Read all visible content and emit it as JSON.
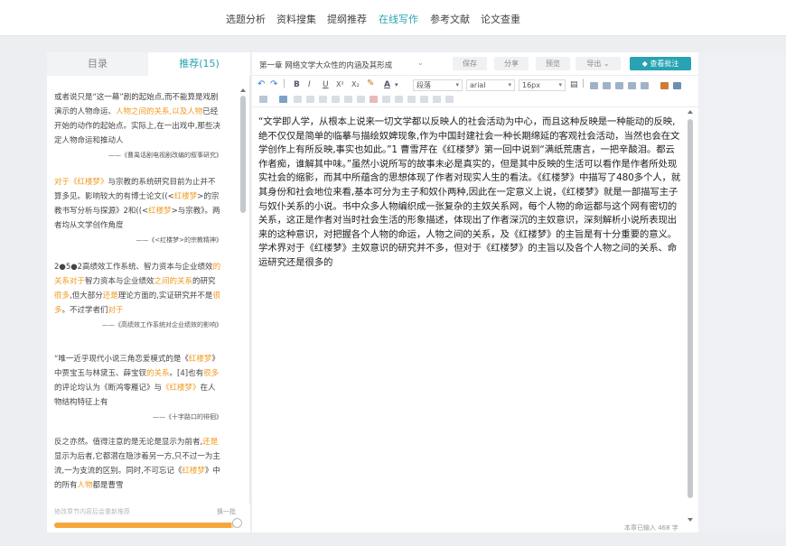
{
  "nav": {
    "items": [
      {
        "label": "选题分析",
        "active": false
      },
      {
        "label": "资料搜集",
        "active": false
      },
      {
        "label": "提纲推荐",
        "active": false
      },
      {
        "label": "在线写作",
        "active": true
      },
      {
        "label": "参考文献",
        "active": false
      },
      {
        "label": "论文查重",
        "active": false
      }
    ],
    "accent_color": "#27a3b3"
  },
  "left_panel": {
    "tabs": {
      "toc": "目录",
      "recommend": "推荐(15)"
    },
    "active_tab": "recommend",
    "recommendations": [
      {
        "segments": [
          {
            "t": "或者说只是“这一幕”剧的起始点,而不能算是戏剧演示的人物命运、",
            "hl": false
          },
          {
            "t": "人物之间的关系,以及人物",
            "hl": true
          },
          {
            "t": "已经开始的动作的起始点。实际上,在一出戏中,那些决定人物命运和推动人",
            "hl": false
          }
        ],
        "source": "——《曹禺话剧电视剧改编的叙事研究》"
      },
      {
        "segments": [
          {
            "t": "对于《红楼梦》",
            "hl": true
          },
          {
            "t": "与宗教的系统研究目前为止并不算多见。影响较大的有博士论文((<",
            "hl": false
          },
          {
            "t": "红楼梦",
            "hl": true
          },
          {
            "t": ">的宗教书写分析与探源》2和((<",
            "hl": false
          },
          {
            "t": "红楼梦",
            "hl": true
          },
          {
            "t": ">与宗教》。两者均从文学创作角度",
            "hl": false
          }
        ],
        "source": "——《<红楼梦>的宗教精神》"
      },
      {
        "segments": [
          {
            "t": "2●5●2高绩效工作系统、智力资本与企业绩效",
            "hl": false
          },
          {
            "t": "的关系对于",
            "hl": true
          },
          {
            "t": "智力资本与企业绩效",
            "hl": false
          },
          {
            "t": "之间的关系",
            "hl": true
          },
          {
            "t": "的研究",
            "hl": false
          },
          {
            "t": "很多",
            "hl": true
          },
          {
            "t": ",但大部分",
            "hl": false
          },
          {
            "t": "还是",
            "hl": true
          },
          {
            "t": "理论方面的,实证研究并不是",
            "hl": false
          },
          {
            "t": "很多",
            "hl": true
          },
          {
            "t": "。不过学者们",
            "hl": false
          },
          {
            "t": "对于",
            "hl": true
          }
        ],
        "source": "——《高绩效工作系统对企业绩效的影响》"
      },
      {
        "segments": [
          {
            "t": "“唯一近乎现代小说三角恋爱模式的是《",
            "hl": false
          },
          {
            "t": "红楼梦",
            "hl": true
          },
          {
            "t": "》中贾宝玉与林黛玉、薛宝钗",
            "hl": false
          },
          {
            "t": "的关系",
            "hl": true
          },
          {
            "t": "。[4]也有",
            "hl": false
          },
          {
            "t": "很多",
            "hl": true
          },
          {
            "t": "的评论均认为《断鸿零雁记》与",
            "hl": false
          },
          {
            "t": "《红楼梦》",
            "hl": true
          },
          {
            "t": "在人物结构特征上有",
            "hl": false
          }
        ],
        "source": "——《十字路口的徘徊》"
      },
      {
        "segments": [
          {
            "t": "反之亦然。值得注意的是无论是显示为前者,",
            "hl": false
          },
          {
            "t": "还是",
            "hl": true
          },
          {
            "t": "显示为后者,它都潜在隐涉着另一方,只不过一为主流,一为支流的区别。同时,不可忘记《",
            "hl": false
          },
          {
            "t": "红楼梦",
            "hl": true
          },
          {
            "t": "》中的所有",
            "hl": false
          },
          {
            "t": "人物",
            "hl": true
          },
          {
            "t": "都是曹雪",
            "hl": false
          }
        ],
        "source": ""
      }
    ],
    "footer_note": "修改章节内容后会重新推荐",
    "refresh_label": "换一批",
    "progress_fraction": 0.98
  },
  "editor": {
    "chapter_title": "第一章 网络文学大众性的内涵及其形成",
    "buttons": {
      "save": "保存",
      "share": "分享",
      "preview": "预览",
      "export": "导出",
      "annotation": "查看批注"
    },
    "toolbar": {
      "bold": "B",
      "italic": "I",
      "underline": "U",
      "superscript": "X²",
      "subscript": "X₂",
      "font_color": "A",
      "paragraph_style": "段落",
      "font_family": "arial",
      "font_size": "16px",
      "omega": "Ω"
    },
    "body_text": "“文学即人学，从根本上说来一切文学都以反映人的社会活动为中心，而且这种反映是一种能动的反映,绝不仅仅是简单的临摹与描绘奴婢现象,作为中国封建社会一种长期绵延的客观社会活动，当然也会在文学创作上有所反映,事实也如此。”1 曹雪芹在《红楼梦》第一回中说到“满纸荒唐言，一把辛酸泪。都云作者痴，谁解其中味。”虽然小说所写的故事未必是真实的，但是其中反映的生活可以看作是作者所处现实社会的缩影，而其中所蕴含的思想体现了作者对现实人生的看法。《红楼梦》中描写了480多个人，就其身份和社会地位来看,基本可分为主子和奴仆两种,因此在一定意义上说，《红楼梦》就是一部描写主子与奴仆关系的小说。书中众多人物编织成一张复杂的主奴关系网，每个人物的命运都与这个网有密切的关系，这正是作者对当时社会生活的形象描述，体现出了作者深沉的主奴意识，深刻解析小说所表现出来的这种意识，对把握各个人物的命运，人物之间的关系，及《红楼梦》的主旨是有十分重要的意义。学术界对于《红楼梦》主奴意识的研究并不多，但对于《红楼梦》的主旨以及各个人物之间的关系、命运研究还是很多的",
    "word_count": "本章已输入 468 字"
  }
}
